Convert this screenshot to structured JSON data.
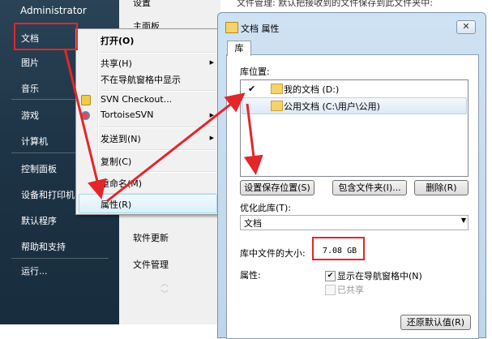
{
  "start_menu": {
    "user": "Administrator",
    "items": [
      "文档",
      "图片",
      "音乐",
      "游戏",
      "计算机",
      "控制面板",
      "设备和打印机",
      "默认程序",
      "帮助和支持",
      "运行..."
    ]
  },
  "middle_pane": {
    "top_clipped": [
      "设置",
      "主面板"
    ],
    "items": [
      "软件更新",
      "文件管理"
    ]
  },
  "top_strip": {
    "text": "文件管理:  默认把接收到的文件保存到此文件夹中:"
  },
  "context_menu": {
    "items": [
      {
        "label": "打开(O)",
        "bold": true
      },
      {
        "label": "共享(H)",
        "submenu": true
      },
      {
        "label": "不在导航窗格中显示"
      },
      {
        "label": "SVN Checkout...",
        "icon": "svn-checkout-icon"
      },
      {
        "label": "TortoiseSVN",
        "icon": "tortoisesvn-icon",
        "submenu": true
      },
      {
        "label": "发送到(N)",
        "submenu": true
      },
      {
        "label": "复制(C)"
      },
      {
        "label": "重命名(M)"
      },
      {
        "label": "属性(R)"
      }
    ]
  },
  "dialog": {
    "title": "文档 属性",
    "close": "✕",
    "tab": "库",
    "library_locations_label": "库位置:",
    "locations": [
      {
        "check": "✔",
        "name": "我的文档 (D:)"
      },
      {
        "check": "",
        "name": "公用文档 (C:\\用户\\公用)"
      }
    ],
    "buttons": {
      "set_save": "设置保存位置(S)",
      "include_folder": "包含文件夹(I)...",
      "remove": "删除(R)",
      "restore": "还原默认值(R)"
    },
    "optimize_label": "优化此库(T):",
    "optimize_value": "文档",
    "size_label": "库中文件的大小:",
    "size_value": "7.08 GB",
    "attributes_label": "属性:",
    "attr_nav": "显示在导航窗格中(N)",
    "attr_shared": "已共享"
  },
  "colors": {
    "annotation_red": "#e3262a",
    "start_bg": "#1d3446"
  }
}
